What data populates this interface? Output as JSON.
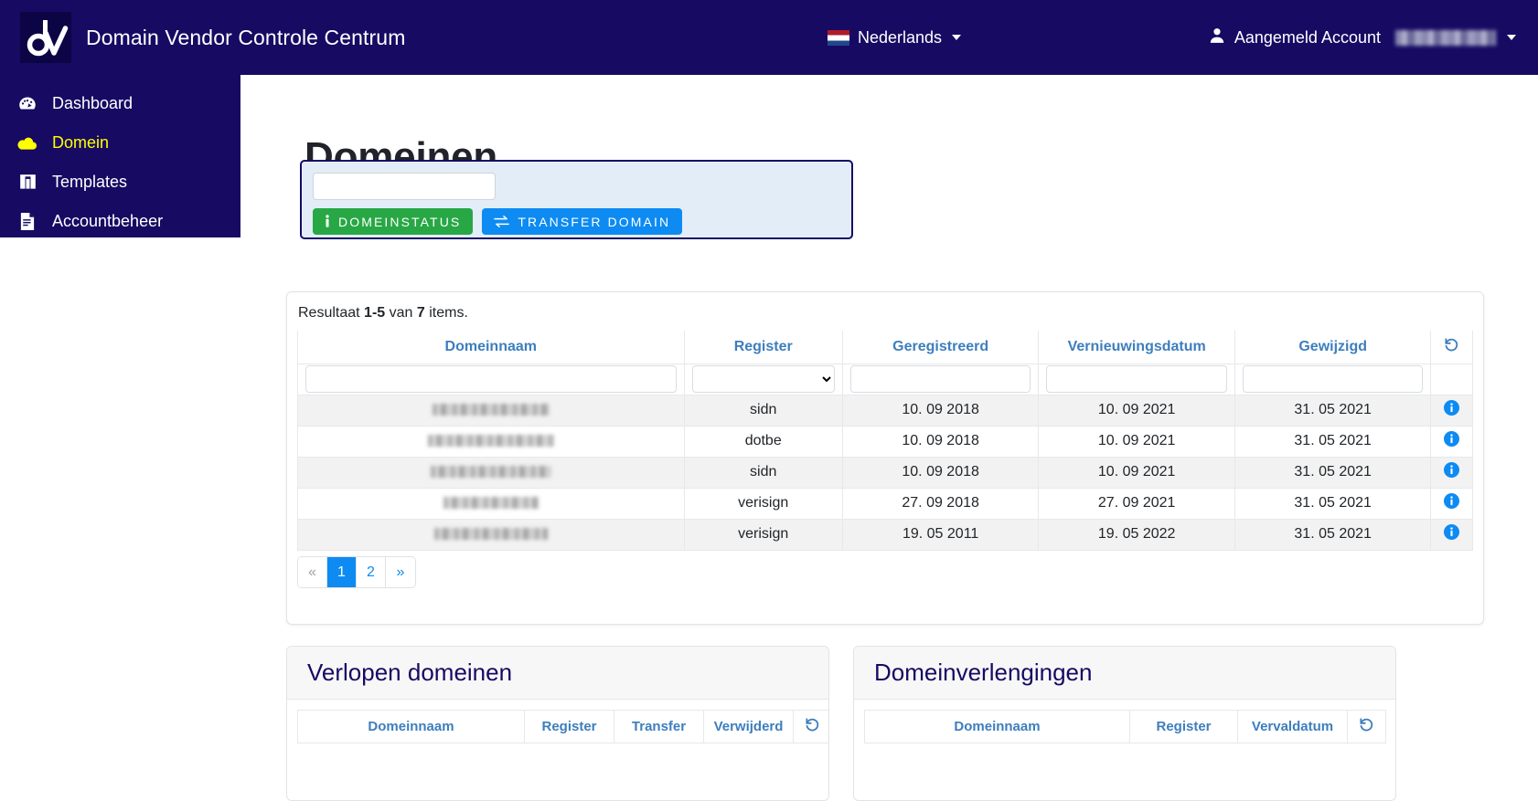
{
  "header": {
    "brand_title": "Domain Vendor Controle Centrum",
    "logo_icon": "dv-logo-icon",
    "language": {
      "label": "Nederlands",
      "flag_icon": "netherlands-flag-icon",
      "caret_icon": "chevron-down-icon"
    },
    "account": {
      "label": "Aangemeld Account",
      "user_icon": "user-icon",
      "name_redacted": "",
      "caret_icon": "chevron-down-icon"
    }
  },
  "sidebar": {
    "items": [
      {
        "label": "Dashboard",
        "icon": "gauge-icon",
        "active": false
      },
      {
        "label": "Domein",
        "icon": "cloud-icon",
        "active": true
      },
      {
        "label": "Templates",
        "icon": "columns-icon",
        "active": false
      },
      {
        "label": "Accountbeheer",
        "icon": "invoice-icon",
        "active": false
      }
    ]
  },
  "main": {
    "page_title": "Domeinen",
    "search": {
      "value": "",
      "placeholder": "",
      "buttons": [
        {
          "label": "DOMEINSTATUS",
          "icon": "info-icon",
          "color": "#28a745"
        },
        {
          "label": "TRANSFER DOMAIN",
          "icon": "exchange-icon",
          "color": "#0d8bf2"
        }
      ]
    },
    "results": {
      "meta_prefix": "Resultaat ",
      "meta_range": "1-5",
      "meta_middle": " van ",
      "meta_total": "7",
      "meta_suffix": " items.",
      "columns": [
        "Domeinnaam",
        "Register",
        "Geregistreerd",
        "Vernieuwingsdatum",
        "Gewijzigd"
      ],
      "reset_icon": "reset-icon",
      "filters": {
        "domein_value": "",
        "register_selected": "",
        "geregistreerd_value": "",
        "vernieuwings_value": "",
        "gewijzigd_value": ""
      },
      "rows": [
        {
          "domein": "",
          "register": "sidn",
          "geregistreerd": "10. 09 2018",
          "vernieuwing": "10. 09 2021",
          "gewijzigd": "31. 05 2021",
          "info_icon": "info-circle-icon"
        },
        {
          "domein": "",
          "register": "dotbe",
          "geregistreerd": "10. 09 2018",
          "vernieuwing": "10. 09 2021",
          "gewijzigd": "31. 05 2021",
          "info_icon": "info-circle-icon"
        },
        {
          "domein": "",
          "register": "sidn",
          "geregistreerd": "10. 09 2018",
          "vernieuwing": "10. 09 2021",
          "gewijzigd": "31. 05 2021",
          "info_icon": "info-circle-icon"
        },
        {
          "domein": "",
          "register": "verisign",
          "geregistreerd": "27. 09 2018",
          "vernieuwing": "27. 09 2021",
          "gewijzigd": "31. 05 2021",
          "info_icon": "info-circle-icon"
        },
        {
          "domein": "",
          "register": "verisign",
          "geregistreerd": "19. 05 2011",
          "vernieuwing": "19. 05 2022",
          "gewijzigd": "31. 05 2021",
          "info_icon": "info-circle-icon"
        }
      ],
      "pagination": [
        {
          "label": "«",
          "state": "muted"
        },
        {
          "label": "1",
          "state": "active"
        },
        {
          "label": "2",
          "state": "normal"
        },
        {
          "label": "»",
          "state": "normal"
        }
      ]
    },
    "panels": [
      {
        "title": "Verlopen domeinen",
        "columns": [
          "Domeinnaam",
          "Register",
          "Transfer",
          "Verwijderd"
        ],
        "reset_icon": "reset-icon"
      },
      {
        "title": "Domeinverlengingen",
        "columns": [
          "Domeinnaam",
          "Register",
          "Vervaldatum"
        ],
        "reset_icon": "reset-icon"
      }
    ]
  },
  "colors": {
    "brand_navy": "#160a63",
    "accent_blue": "#0d8bf2",
    "accent_green": "#28a745",
    "active_yellow": "#ffff00",
    "header_link": "#3d7ebd"
  }
}
